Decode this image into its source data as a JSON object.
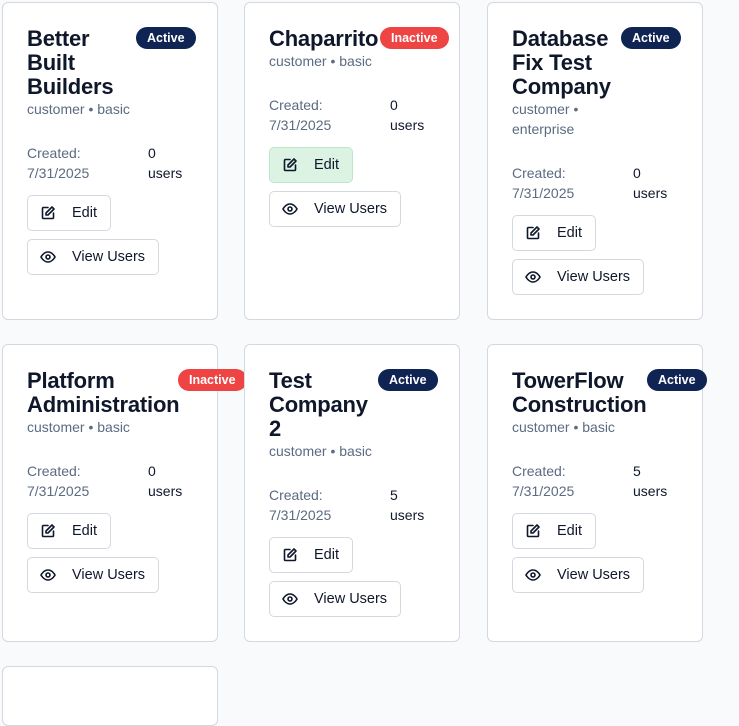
{
  "colors": {
    "active_badge": "#0f2452",
    "inactive_badge": "#ef4444",
    "edit_hover": "#dcf3e4"
  },
  "labels": {
    "created": "Created:",
    "users": "users",
    "edit": "Edit",
    "view_users": "View Users"
  },
  "companies": [
    {
      "name": "Better Built Builders",
      "status": "Active",
      "meta": "customer • basic",
      "created": "7/31/2025",
      "users": "0"
    },
    {
      "name": "Chaparrito",
      "status": "Inactive",
      "meta": "customer • basic",
      "created": "7/31/2025",
      "users": "0"
    },
    {
      "name": "Database Fix Test Company",
      "status": "Active",
      "meta": "customer • enterprise",
      "created": "7/31/2025",
      "users": "0"
    },
    {
      "name": "Platform Administration",
      "status": "Inactive",
      "meta": "customer • basic",
      "created": "7/31/2025",
      "users": "0"
    },
    {
      "name": "Test Company 2",
      "status": "Active",
      "meta": "customer • basic",
      "created": "7/31/2025",
      "users": "5"
    },
    {
      "name": "TowerFlow Construction",
      "status": "Active",
      "meta": "customer • basic",
      "created": "7/31/2025",
      "users": "5"
    }
  ]
}
